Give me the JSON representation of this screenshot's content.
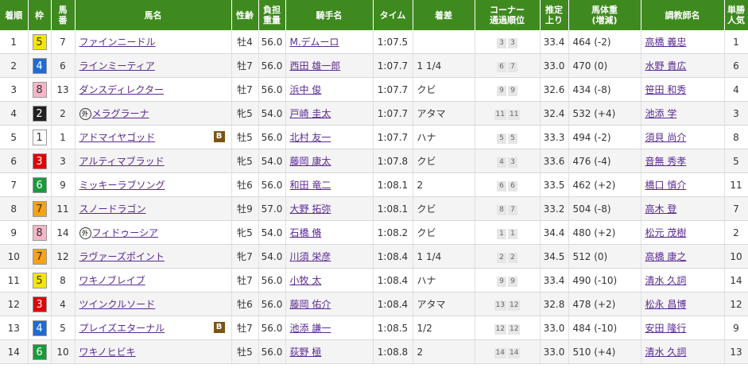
{
  "colors": {
    "header_bg": "#3f8a1f",
    "link": "#5a2a91",
    "waku": {
      "1": {
        "bg": "#ffffff",
        "fg": "#333333"
      },
      "2": {
        "bg": "#222222",
        "fg": "#ffffff"
      },
      "3": {
        "bg": "#e00000",
        "fg": "#ffffff"
      },
      "4": {
        "bg": "#1f6bd6",
        "fg": "#ffffff"
      },
      "5": {
        "bg": "#f5e600",
        "fg": "#333333"
      },
      "6": {
        "bg": "#1a9a3a",
        "fg": "#ffffff"
      },
      "7": {
        "bg": "#f6a212",
        "fg": "#333333"
      },
      "8": {
        "bg": "#f7b6c8",
        "fg": "#333333"
      }
    }
  },
  "headers": {
    "rank": "着順",
    "waku": "枠",
    "num_a": "馬",
    "num_b": "番",
    "horse": "馬名",
    "sexage": "性齢",
    "burden_a": "負担",
    "burden_b": "重量",
    "jockey": "騎手名",
    "time": "タイム",
    "margin": "着差",
    "corner_a": "コーナー",
    "corner_b": "通過順位",
    "last3f_a": "推定",
    "last3f_b": "上り",
    "bodyweight_a": "馬体重",
    "bodyweight_b": "(増減)",
    "trainer": "調教師名",
    "pop_a": "単勝",
    "pop_b": "人気"
  },
  "marks": {
    "foreign": "外",
    "blinker": "B"
  },
  "rows": [
    {
      "rank": "1",
      "waku": "5",
      "num": "7",
      "horse": "ファインニードル",
      "foreign": false,
      "blinker": false,
      "sexage": "牡4",
      "burden": "56.0",
      "jockey": "M.デムーロ",
      "time": "1:07.5",
      "margin": "",
      "corner1": "3",
      "corner2": "3",
      "last3f": "33.4",
      "bodyweight": "464 (-2)",
      "trainer": "高橋 義忠",
      "pop": "1"
    },
    {
      "rank": "2",
      "waku": "4",
      "num": "6",
      "horse": "ラインミーティア",
      "foreign": false,
      "blinker": false,
      "sexage": "牡7",
      "burden": "56.0",
      "jockey": "西田 雄一郎",
      "time": "1:07.7",
      "margin": "1 1/4",
      "corner1": "6",
      "corner2": "7",
      "last3f": "33.0",
      "bodyweight": "470 (0)",
      "trainer": "水野 貴広",
      "pop": "6"
    },
    {
      "rank": "3",
      "waku": "8",
      "num": "13",
      "horse": "ダンスディレクター",
      "foreign": false,
      "blinker": false,
      "sexage": "牡7",
      "burden": "56.0",
      "jockey": "浜中 俊",
      "time": "1:07.7",
      "margin": "クビ",
      "corner1": "9",
      "corner2": "9",
      "last3f": "32.6",
      "bodyweight": "434 (-8)",
      "trainer": "笹田 和秀",
      "pop": "4"
    },
    {
      "rank": "4",
      "waku": "2",
      "num": "2",
      "horse": "メラグラーナ",
      "foreign": true,
      "blinker": false,
      "sexage": "牝5",
      "burden": "54.0",
      "jockey": "戸崎 圭太",
      "time": "1:07.7",
      "margin": "アタマ",
      "corner1": "11",
      "corner2": "11",
      "last3f": "32.4",
      "bodyweight": "532 (+4)",
      "trainer": "池添 学",
      "pop": "3"
    },
    {
      "rank": "5",
      "waku": "1",
      "num": "1",
      "horse": "アドマイヤゴッド",
      "foreign": false,
      "blinker": true,
      "sexage": "牡5",
      "burden": "56.0",
      "jockey": "北村 友一",
      "time": "1:07.7",
      "margin": "ハナ",
      "corner1": "5",
      "corner2": "5",
      "last3f": "33.3",
      "bodyweight": "494 (-2)",
      "trainer": "須貝 尚介",
      "pop": "8"
    },
    {
      "rank": "6",
      "waku": "3",
      "num": "3",
      "horse": "アルティマブラッド",
      "foreign": false,
      "blinker": false,
      "sexage": "牝5",
      "burden": "54.0",
      "jockey": "藤岡 康太",
      "time": "1:07.8",
      "margin": "クビ",
      "corner1": "4",
      "corner2": "3",
      "last3f": "33.6",
      "bodyweight": "476 (-4)",
      "trainer": "音無 秀孝",
      "pop": "5"
    },
    {
      "rank": "7",
      "waku": "6",
      "num": "9",
      "horse": "ミッキーラブソング",
      "foreign": false,
      "blinker": false,
      "sexage": "牡6",
      "burden": "56.0",
      "jockey": "和田 竜二",
      "time": "1:08.1",
      "margin": "2",
      "corner1": "6",
      "corner2": "6",
      "last3f": "33.5",
      "bodyweight": "462 (+2)",
      "trainer": "橋口 慎介",
      "pop": "11"
    },
    {
      "rank": "8",
      "waku": "7",
      "num": "11",
      "horse": "スノードラゴン",
      "foreign": false,
      "blinker": false,
      "sexage": "牡9",
      "burden": "57.0",
      "jockey": "大野 拓弥",
      "time": "1:08.1",
      "margin": "クビ",
      "corner1": "8",
      "corner2": "7",
      "last3f": "33.2",
      "bodyweight": "504 (-8)",
      "trainer": "高木 登",
      "pop": "7"
    },
    {
      "rank": "9",
      "waku": "8",
      "num": "14",
      "horse": "フィドゥーシア",
      "foreign": true,
      "blinker": false,
      "sexage": "牝5",
      "burden": "54.0",
      "jockey": "石橋 脩",
      "time": "1:08.2",
      "margin": "クビ",
      "corner1": "1",
      "corner2": "1",
      "last3f": "34.4",
      "bodyweight": "480 (+2)",
      "trainer": "松元 茂樹",
      "pop": "2"
    },
    {
      "rank": "10",
      "waku": "7",
      "num": "12",
      "horse": "ラヴァーズポイント",
      "foreign": false,
      "blinker": false,
      "sexage": "牝7",
      "burden": "54.0",
      "jockey": "川須 栄彦",
      "time": "1:08.4",
      "margin": "1 1/4",
      "corner1": "2",
      "corner2": "2",
      "last3f": "34.5",
      "bodyweight": "512 (0)",
      "trainer": "高橋 康之",
      "pop": "10"
    },
    {
      "rank": "11",
      "waku": "5",
      "num": "8",
      "horse": "ワキノブレイブ",
      "foreign": false,
      "blinker": false,
      "sexage": "牡7",
      "burden": "56.0",
      "jockey": "小牧 太",
      "time": "1:08.4",
      "margin": "ハナ",
      "corner1": "9",
      "corner2": "9",
      "last3f": "33.4",
      "bodyweight": "490 (-10)",
      "trainer": "清水 久詞",
      "pop": "14"
    },
    {
      "rank": "12",
      "waku": "3",
      "num": "4",
      "horse": "ツインクルソード",
      "foreign": false,
      "blinker": false,
      "sexage": "牡6",
      "burden": "56.0",
      "jockey": "藤岡 佑介",
      "time": "1:08.4",
      "margin": "アタマ",
      "corner1": "13",
      "corner2": "12",
      "last3f": "32.8",
      "bodyweight": "478 (+2)",
      "trainer": "松永 昌博",
      "pop": "12"
    },
    {
      "rank": "13",
      "waku": "4",
      "num": "5",
      "horse": "プレイズエターナル",
      "foreign": false,
      "blinker": true,
      "sexage": "牡7",
      "burden": "56.0",
      "jockey": "池添 謙一",
      "time": "1:08.5",
      "margin": "1/2",
      "corner1": "12",
      "corner2": "12",
      "last3f": "33.0",
      "bodyweight": "484 (-10)",
      "trainer": "安田 隆行",
      "pop": "9"
    },
    {
      "rank": "14",
      "waku": "6",
      "num": "10",
      "horse": "ワキノヒビキ",
      "foreign": false,
      "blinker": false,
      "sexage": "牡5",
      "burden": "56.0",
      "jockey": "荻野 極",
      "time": "1:08.8",
      "margin": "2",
      "corner1": "14",
      "corner2": "14",
      "last3f": "33.0",
      "bodyweight": "510 (+4)",
      "trainer": "清水 久詞",
      "pop": "13"
    }
  ]
}
